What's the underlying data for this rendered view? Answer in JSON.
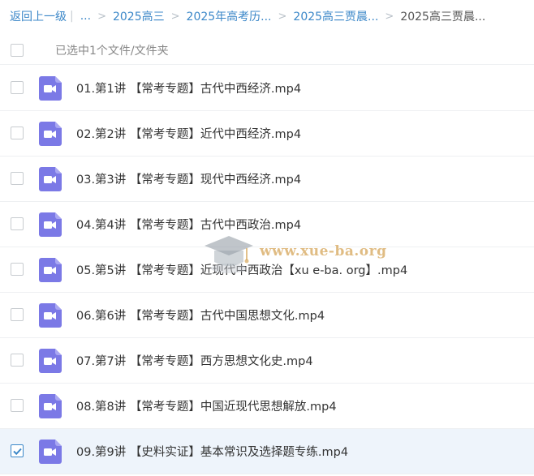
{
  "breadcrumb": {
    "back": "返回上一级",
    "pipe": "|",
    "ellipsis": "...",
    "items": [
      "2025高三",
      "2025年高考历...",
      "2025高三贾晨..."
    ],
    "current": "2025高三贾晨...",
    "separator": ">"
  },
  "selection": {
    "label": "已选中1个文件/文件夹"
  },
  "files": [
    {
      "name": "01.第1讲 【常考专题】古代中西经济.mp4",
      "checked": false
    },
    {
      "name": "02.第2讲 【常考专题】近代中西经济.mp4",
      "checked": false
    },
    {
      "name": "03.第3讲 【常考专题】现代中西经济.mp4",
      "checked": false
    },
    {
      "name": "04.第4讲 【常考专题】古代中西政治.mp4",
      "checked": false
    },
    {
      "name": "05.第5讲 【常考专题】近现代中西政治【xu e-ba. org】.mp4",
      "checked": false
    },
    {
      "name": "06.第6讲 【常考专题】古代中国思想文化.mp4",
      "checked": false
    },
    {
      "name": "07.第7讲 【常考专题】西方思想文化史.mp4",
      "checked": false
    },
    {
      "name": "08.第8讲 【常考专题】中国近现代思想解放.mp4",
      "checked": false
    },
    {
      "name": "09.第9讲 【史料实证】基本常识及选择题专练.mp4",
      "checked": true
    }
  ],
  "file_icon": "video-file-icon",
  "watermark": {
    "text": "www.xue-ba.org",
    "icon": "graduation-cap-icon"
  },
  "colors": {
    "accent": "#3b87c8",
    "icon_purple": "#7b79e6",
    "selected_row": "#eef4fb"
  }
}
